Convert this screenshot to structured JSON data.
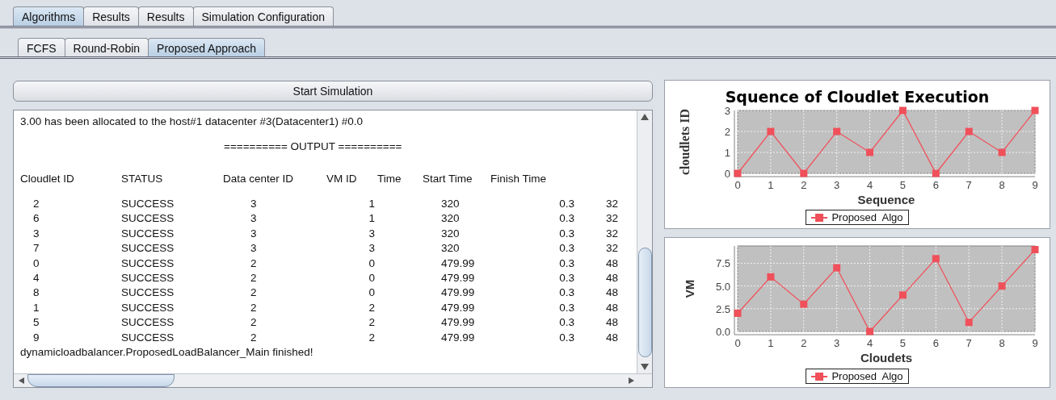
{
  "tabs": [
    {
      "label": "Algorithms",
      "selected": true
    },
    {
      "label": "Results",
      "selected": false
    },
    {
      "label": "Results",
      "selected": false
    },
    {
      "label": "Simulation Configuration",
      "selected": false
    }
  ],
  "subtabs": [
    {
      "label": "FCFS",
      "selected": false
    },
    {
      "label": "Round-Robin",
      "selected": false
    },
    {
      "label": "Proposed Approach",
      "selected": true
    }
  ],
  "start_button": "Start Simulation",
  "console": {
    "lines": [
      "3.00 has been allocated to the host#1 datacenter #3(Datacenter1) #0.0"
    ],
    "output_heading": "========== OUTPUT ==========",
    "columns": [
      "Cloudlet ID",
      "STATUS",
      "Data center ID",
      "VM ID",
      "Time",
      "Start Time",
      "Finish Time",
      ""
    ],
    "rows": [
      [
        "2",
        "SUCCESS",
        "3",
        "1",
        "",
        "320",
        "0.3",
        "32"
      ],
      [
        "6",
        "SUCCESS",
        "3",
        "1",
        "",
        "320",
        "0.3",
        "32"
      ],
      [
        "3",
        "SUCCESS",
        "3",
        "3",
        "",
        "320",
        "0.3",
        "32"
      ],
      [
        "7",
        "SUCCESS",
        "3",
        "3",
        "",
        "320",
        "0.3",
        "32"
      ],
      [
        "0",
        "SUCCESS",
        "2",
        "0",
        "",
        "479.99",
        "0.3",
        "48"
      ],
      [
        "4",
        "SUCCESS",
        "2",
        "0",
        "",
        "479.99",
        "0.3",
        "48"
      ],
      [
        "8",
        "SUCCESS",
        "2",
        "0",
        "",
        "479.99",
        "0.3",
        "48"
      ],
      [
        "1",
        "SUCCESS",
        "2",
        "2",
        "",
        "479.99",
        "0.3",
        "48"
      ],
      [
        "5",
        "SUCCESS",
        "2",
        "2",
        "",
        "479.99",
        "0.3",
        "48"
      ],
      [
        "9",
        "SUCCESS",
        "2",
        "2",
        "",
        "479.99",
        "0.3",
        "48"
      ]
    ],
    "footer": "dynamicloadbalancer.ProposedLoadBalancer_Main finished!"
  },
  "charts": [
    {
      "chart_data": {
        "type": "line",
        "title": "Squence of Cloudlet Execution",
        "xlabel": "Sequence",
        "ylabel": "cloudlets ID",
        "x": [
          0,
          1,
          2,
          3,
          4,
          5,
          6,
          7,
          8,
          9
        ],
        "xlim": [
          0,
          9
        ],
        "ylim": [
          0,
          3
        ],
        "xticks": [
          0,
          1,
          2,
          3,
          4,
          5,
          6,
          7,
          8,
          9
        ],
        "yticks": [
          0,
          1,
          2,
          3
        ],
        "grid": true,
        "series": [
          {
            "name": "Proposed  Algo",
            "color": "#f0505a",
            "marker": "square",
            "values": [
              0,
              2,
              0,
              2,
              1,
              3,
              0,
              2,
              1,
              3
            ]
          }
        ]
      }
    },
    {
      "chart_data": {
        "type": "line",
        "xlabel": "Cloudets",
        "ylabel": "VM",
        "x": [
          0,
          1,
          2,
          3,
          4,
          5,
          6,
          7,
          8,
          9
        ],
        "xlim": [
          0,
          9
        ],
        "ylim": [
          0,
          9.4
        ],
        "xticks": [
          0,
          1,
          2,
          3,
          4,
          5,
          6,
          7,
          8,
          9
        ],
        "yticks": [
          {
            "value": 0,
            "label": "0.0"
          },
          {
            "value": 2.5,
            "label": "2.5"
          },
          {
            "value": 5,
            "label": "5.0"
          },
          {
            "value": 7.5,
            "label": "7.5"
          }
        ],
        "grid": true,
        "series": [
          {
            "name": "Proposed  Algo",
            "color": "#f0505a",
            "marker": "square",
            "values": [
              2,
              6,
              3,
              7,
              0,
              4,
              8,
              1,
              5,
              9
            ]
          }
        ]
      }
    }
  ]
}
